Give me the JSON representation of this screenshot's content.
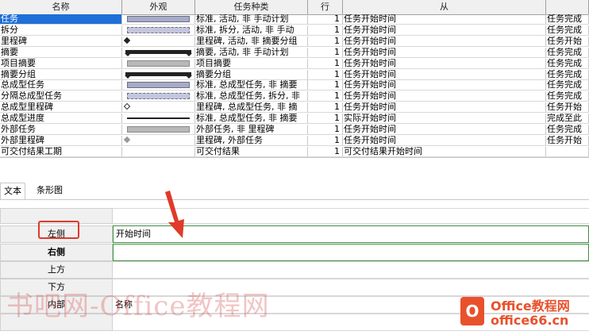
{
  "grid": {
    "headers": {
      "name": "名称",
      "look": "外观",
      "kind": "任务种类",
      "row": "行",
      "from": "从",
      "to": ""
    },
    "rows": [
      {
        "name": "任务",
        "look": "bar",
        "kind": "标准, 活动, 非 手动计划",
        "row": "1",
        "from": "任务开始时间",
        "to": "任务完成",
        "selected": true
      },
      {
        "name": "拆分",
        "look": "dashed",
        "kind": "标准, 拆分, 活动, 非 手动",
        "row": "1",
        "from": "任务开始时间",
        "to": "任务完成"
      },
      {
        "name": "里程碑",
        "look": "diamond",
        "kind": "里程碑, 活动, 非 摘要分组",
        "row": "1",
        "from": "任务开始时间",
        "to": "任务开始"
      },
      {
        "name": "摘要",
        "look": "summary",
        "kind": "摘要, 活动, 非 手动计划",
        "row": "1",
        "from": "任务开始时间",
        "to": "任务完成"
      },
      {
        "name": "项目摘要",
        "look": "gray-bar",
        "kind": "项目摘要",
        "row": "1",
        "from": "任务开始时间",
        "to": "任务完成"
      },
      {
        "name": "摘要分组",
        "look": "summary",
        "kind": "摘要分组",
        "row": "1",
        "from": "任务开始时间",
        "to": "任务完成"
      },
      {
        "name": "总成型任务",
        "look": "bar",
        "kind": "标准, 总成型任务, 非 摘要",
        "row": "1",
        "from": "任务开始时间",
        "to": "任务完成"
      },
      {
        "name": "分隔总成型任务",
        "look": "dashed",
        "kind": "标准, 总成型任务, 拆分, 非",
        "row": "1",
        "from": "任务开始时间",
        "to": "任务完成"
      },
      {
        "name": "总成型里程碑",
        "look": "hollow-diamond",
        "kind": "里程碑, 总成型任务, 非 摘",
        "row": "1",
        "from": "任务开始时间",
        "to": "任务开始"
      },
      {
        "name": "总成型进度",
        "look": "thin",
        "kind": "标准, 总成型任务, 非 摘要",
        "row": "1",
        "from": "实际开始时间",
        "to": "完成至此"
      },
      {
        "name": "外部任务",
        "look": "gray-bar",
        "kind": "外部任务, 非 里程碑",
        "row": "1",
        "from": "任务开始时间",
        "to": "任务完成"
      },
      {
        "name": "外部里程碑",
        "look": "gray-diamond",
        "kind": "里程碑, 外部任务",
        "row": "1",
        "from": "任务开始时间",
        "to": "任务开始"
      },
      {
        "name": "可交付结果工期",
        "look": "none",
        "kind": "可交付结果",
        "row": "1",
        "from": "可交付结果开始时间",
        "to": ""
      }
    ]
  },
  "tabs": {
    "text": "文本",
    "bar_shape": "条形图"
  },
  "props": {
    "left": {
      "label": "左侧",
      "value": "开始时间"
    },
    "right": {
      "label": "右侧",
      "value": ""
    },
    "top": {
      "label": "上方",
      "value": ""
    },
    "bottom": {
      "label": "下方",
      "value": ""
    },
    "inside": {
      "label": "内部",
      "value": "名称"
    }
  },
  "watermark": "书吧网-Office教程网",
  "logo": {
    "line1": "Office教程网",
    "line2": "office66.cn"
  },
  "colors": {
    "selection": "#1f6fd8",
    "callout": "#e03a2a",
    "brand": "#e8512c",
    "edit_border": "#3f8f3f"
  }
}
